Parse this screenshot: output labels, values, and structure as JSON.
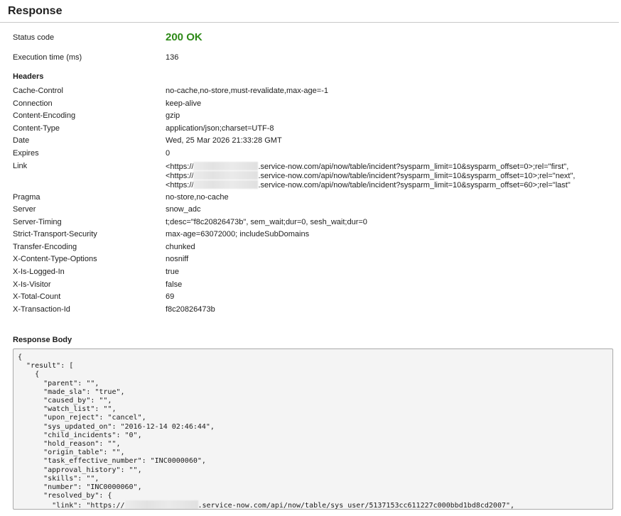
{
  "title": "Response",
  "status": {
    "label": "Status code",
    "value": "200 OK",
    "color": "#2e8a18"
  },
  "execution": {
    "label": "Execution time (ms)",
    "value": "136"
  },
  "headers_heading": "Headers",
  "headers": [
    {
      "name": "Cache-Control",
      "value": "no-cache,no-store,must-revalidate,max-age=-1"
    },
    {
      "name": "Connection",
      "value": "keep-alive"
    },
    {
      "name": "Content-Encoding",
      "value": "gzip"
    },
    {
      "name": "Content-Type",
      "value": "application/json;charset=UTF-8"
    },
    {
      "name": "Date",
      "value": "Wed, 25 Mar 2026 21:33:28 GMT"
    },
    {
      "name": "Expires",
      "value": "0"
    }
  ],
  "link": {
    "name": "Link",
    "lines": [
      {
        "prefix": "<https://",
        "suffix": ".service-now.com/api/now/table/incident?sysparm_limit=10&sysparm_offset=0>;rel=\"first\","
      },
      {
        "prefix": "<https://",
        "suffix": ".service-now.com/api/now/table/incident?sysparm_limit=10&sysparm_offset=10>;rel=\"next\","
      },
      {
        "prefix": "<https://",
        "suffix": ".service-now.com/api/now/table/incident?sysparm_limit=10&sysparm_offset=60>;rel=\"last\""
      }
    ]
  },
  "headers_after": [
    {
      "name": "Pragma",
      "value": "no-store,no-cache"
    },
    {
      "name": "Server",
      "value": "snow_adc"
    },
    {
      "name": "Server-Timing",
      "value": "t;desc=\"f8c20826473b\", sem_wait;dur=0, sesh_wait;dur=0"
    },
    {
      "name": "Strict-Transport-Security",
      "value": "max-age=63072000; includeSubDomains"
    },
    {
      "name": "Transfer-Encoding",
      "value": "chunked"
    },
    {
      "name": "X-Content-Type-Options",
      "value": "nosniff"
    },
    {
      "name": "X-Is-Logged-In",
      "value": "true"
    },
    {
      "name": "X-Is-Visitor",
      "value": "false"
    },
    {
      "name": "X-Total-Count",
      "value": "69"
    },
    {
      "name": "X-Transaction-Id",
      "value": "f8c20826473b"
    }
  ],
  "body_heading": "Response Body",
  "body_lines": [
    "{",
    "  \"result\": [",
    "    {",
    "      \"parent\": \"\",",
    "      \"made_sla\": \"true\",",
    "      \"caused_by\": \"\",",
    "      \"watch_list\": \"\",",
    "      \"upon_reject\": \"cancel\",",
    "      \"sys_updated_on\": \"2016-12-14 02:46:44\",",
    "      \"child_incidents\": \"0\",",
    "      \"hold_reason\": \"\",",
    "      \"origin_table\": \"\",",
    "      \"task_effective_number\": \"INC0000060\",",
    "      \"approval_history\": \"\",",
    "      \"skills\": \"\",",
    "      \"number\": \"INC0000060\",",
    "      \"resolved_by\": {"
  ],
  "body_link_line": {
    "prefix": "        \"link\": \"https://",
    "suffix": ".service-now.com/api/now/table/sys_user/5137153cc611227c000bbd1bd8cd2007\","
  }
}
